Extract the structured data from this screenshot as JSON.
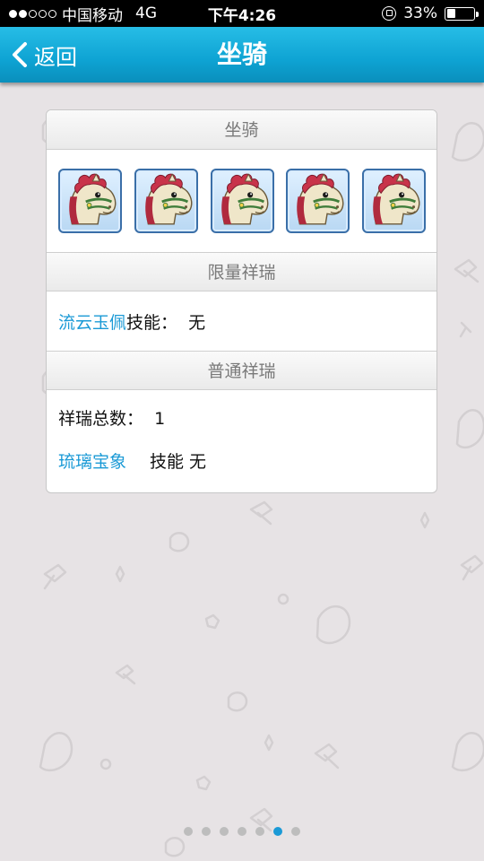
{
  "status_bar": {
    "carrier": "中国移动",
    "network": "4G",
    "time": "下午4:26",
    "battery_percent": "33%",
    "battery_level": 0.33,
    "signal_bars": 2
  },
  "nav": {
    "back_label": "返回",
    "title": "坐骑"
  },
  "card": {
    "mount_section_title": "坐骑",
    "mounts": [
      {
        "icon": "horse-mount-icon"
      },
      {
        "icon": "horse-mount-icon"
      },
      {
        "icon": "horse-mount-icon"
      },
      {
        "icon": "horse-mount-icon"
      },
      {
        "icon": "horse-mount-icon"
      }
    ],
    "limited_section_title": "限量祥瑞",
    "limited_item": {
      "name": "流云玉佩",
      "skill_text": "技能：  无"
    },
    "normal_section_title": "普通祥瑞",
    "normal_total": "祥瑞总数：  1",
    "normal_item": {
      "name": "琉璃宝象",
      "skill_text": "技能 无"
    }
  },
  "pagination": {
    "total": 7,
    "active_index": 5
  },
  "colors": {
    "nav_blue": "#0ea3d3",
    "link_blue": "#1b9ad6",
    "background": "#e7e3e5"
  }
}
